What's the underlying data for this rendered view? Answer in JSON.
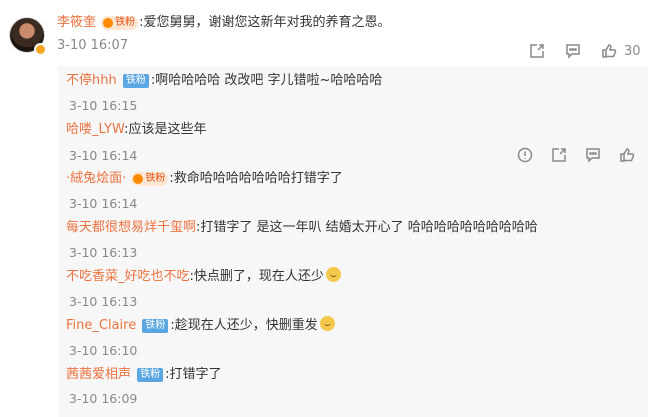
{
  "main": {
    "author": "李筱奎",
    "badge_gold": "铁粉",
    "text": ":爱您舅舅，谢谢您这新年对我的养育之恩。",
    "time": "3-10 16:07",
    "like_count": "30"
  },
  "replies": [
    {
      "name": "不停hhh",
      "badge": "铁粉",
      "text": ":啊哈哈哈哈 改改吧 字儿错啦~哈哈哈哈",
      "time": "3-10 16:15"
    },
    {
      "name": "哈喽_LYW",
      "badge": "",
      "text": ":应该是这些年",
      "time": "3-10 16:14"
    },
    {
      "name": "·絨兔烩面·",
      "badge": "铁粉",
      "text": ":救命哈哈哈哈哈哈哈打错字了",
      "time": "3-10 16:14"
    },
    {
      "name": "每天都很想易烊千玺啊",
      "badge": "",
      "text": ":打错字了 是这一年叭 结婚太开心了 哈哈哈哈哈哈哈哈哈哈",
      "time": "3-10 16:13"
    },
    {
      "name": "不吃香菜_好吃也不吃",
      "badge": "",
      "text": ":快点删了，现在人还少",
      "time": "3-10 16:13"
    },
    {
      "name": "Fine_Claire",
      "badge": "铁粉",
      "text": ":趁现在人还少，快删重发",
      "time": "3-10 16:10"
    },
    {
      "name": "茜茜爱相声",
      "badge": "铁粉",
      "text": ":打错字了",
      "time": "3-10 16:09"
    }
  ]
}
